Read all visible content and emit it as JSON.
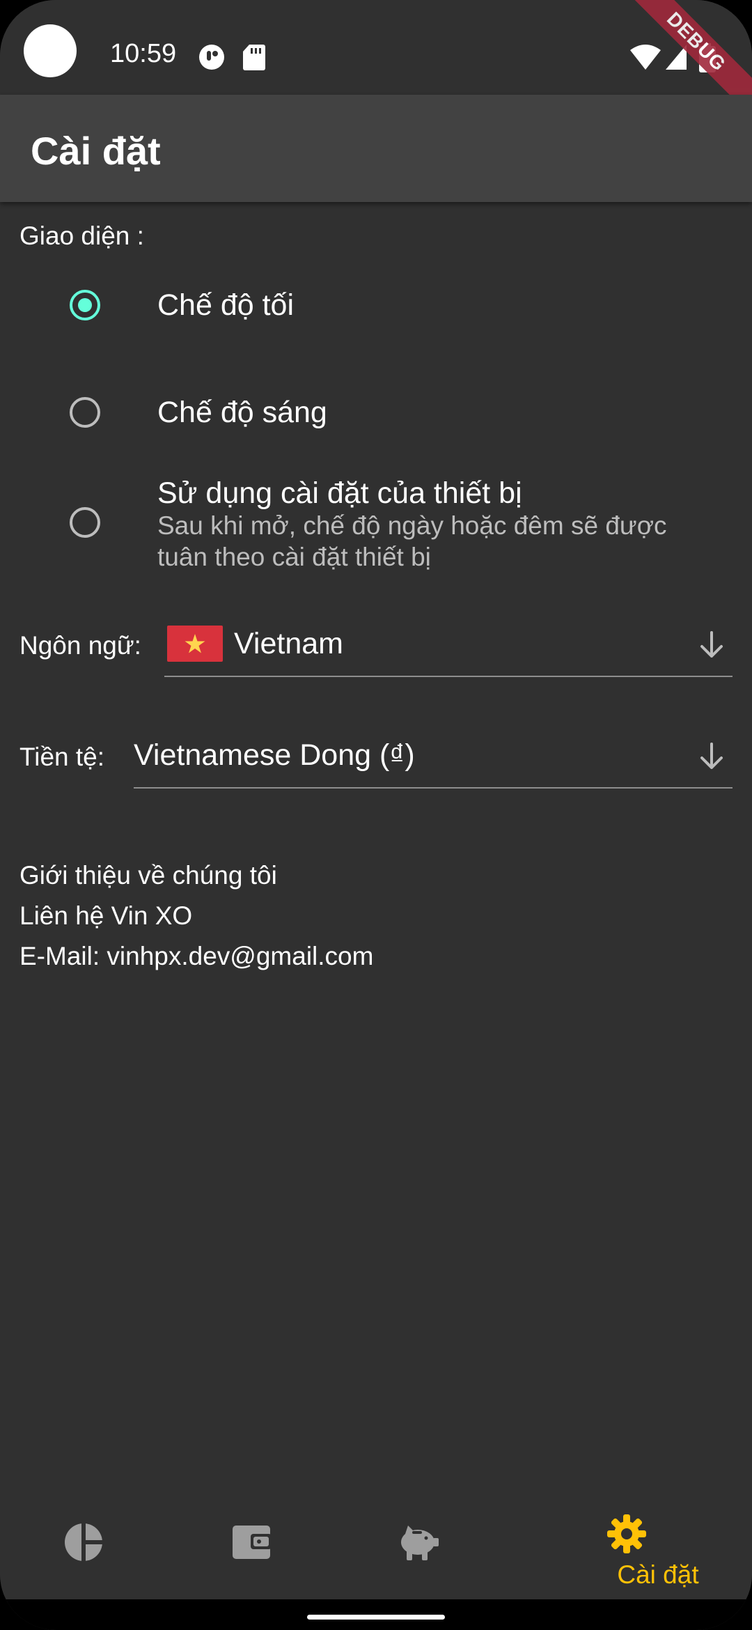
{
  "status_bar": {
    "time": "10:59",
    "debug_banner": "DEBUG"
  },
  "app_bar": {
    "title": "Cài đặt"
  },
  "theme_section": {
    "label": "Giao diện :",
    "options": [
      {
        "title": "Chế độ tối",
        "selected": true
      },
      {
        "title": "Chế độ sáng",
        "selected": false
      },
      {
        "title": "Sử dụng cài đặt của thiết bị",
        "subtitle": "Sau khi mở, chế độ ngày hoặc đêm sẽ được tuân theo cài đặt thiết bị",
        "selected": false
      }
    ]
  },
  "language": {
    "label": "Ngôn ngữ:",
    "value": "Vietnam",
    "flag_icon": "vietnam-flag-icon"
  },
  "currency": {
    "label": "Tiền tệ:",
    "value": "Vietnamese Dong (₫)"
  },
  "about": {
    "line1": "Giới thiệu về chúng tôi",
    "line2": "Liên hệ Vin XO",
    "line3": "E-Mail: vinhpx.dev@gmail.com"
  },
  "bottom_nav": {
    "items": [
      {
        "icon": "pie-chart-icon",
        "label": ""
      },
      {
        "icon": "wallet-icon",
        "label": ""
      },
      {
        "icon": "piggy-bank-icon",
        "label": ""
      },
      {
        "icon": "gear-icon",
        "label": "Cài đặt",
        "active": true
      }
    ]
  },
  "colors": {
    "accent": "#64ffda",
    "active_nav": "#ffc107",
    "background": "#303030",
    "app_bar": "#424242"
  }
}
